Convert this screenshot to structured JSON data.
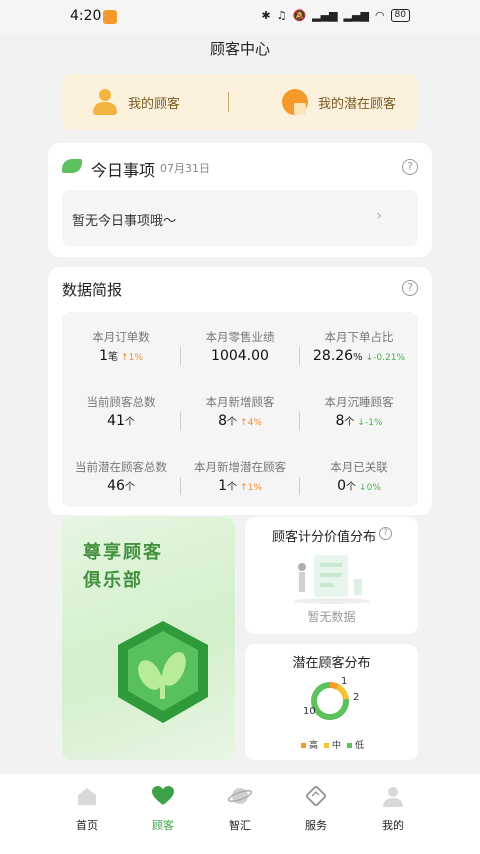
{
  "status_bar": {
    "time": "4:20",
    "battery": "80"
  },
  "header": {
    "title": "顾客中心"
  },
  "quick_links": [
    {
      "label": "我的顾客",
      "icon": "customer-icon"
    },
    {
      "label": "我的潜在顾客",
      "icon": "prospect-icon"
    }
  ],
  "today": {
    "title": "今日事项",
    "date": "07月31日",
    "empty_text": "暂无今日事项哦～",
    "help": "?"
  },
  "data_report": {
    "title": "数据简报",
    "help": "?",
    "stats": [
      {
        "label": "本月订单数",
        "value": "1",
        "unit": "笔",
        "trend": "1%",
        "direction": "up"
      },
      {
        "label": "本月零售业绩",
        "value": "1004.00",
        "unit": "",
        "trend": "",
        "direction": ""
      },
      {
        "label": "本月下单占比",
        "value": "28.26",
        "unit": "%",
        "trend": "-0.21%",
        "direction": "down"
      },
      {
        "label": "当前顾客总数",
        "value": "41",
        "unit": "个",
        "trend": "",
        "direction": ""
      },
      {
        "label": "本月新增顾客",
        "value": "8",
        "unit": "个",
        "trend": "4%",
        "direction": "up"
      },
      {
        "label": "本月沉睡顾客",
        "value": "8",
        "unit": "个",
        "trend": "-1%",
        "direction": "down"
      },
      {
        "label": "当前潜在顾客总数",
        "value": "46",
        "unit": "个",
        "trend": "",
        "direction": ""
      },
      {
        "label": "本月新增潜在顾客",
        "value": "1",
        "unit": "个",
        "trend": "1%",
        "direction": "up"
      },
      {
        "label": "本月已关联",
        "value": "0",
        "unit": "个",
        "trend": "0%",
        "direction": "down"
      }
    ]
  },
  "club": {
    "title_line1": "尊享顾客",
    "title_line2": "俱乐部"
  },
  "score_distribution": {
    "title": "顾客计分价值分布",
    "help": "?",
    "empty_text": "暂无数据"
  },
  "potential_distribution": {
    "title": "潜在顾客分布",
    "labels": {
      "high_count": "1",
      "mid_count": "2",
      "low_count": "10"
    },
    "legend": [
      {
        "label": "高",
        "color": "#f59a2a"
      },
      {
        "label": "中",
        "color": "#f2c530"
      },
      {
        "label": "低",
        "color": "#5cc15f"
      }
    ]
  },
  "chart_data": {
    "type": "pie",
    "title": "潜在顾客分布",
    "categories": [
      "高",
      "中",
      "低"
    ],
    "values": [
      1,
      2,
      10
    ]
  },
  "tabbar": {
    "active": "顾客",
    "tabs": [
      {
        "label": "首页",
        "icon": "home-icon"
      },
      {
        "label": "顾客",
        "icon": "heart-icon"
      },
      {
        "label": "智汇",
        "icon": "planet-icon"
      },
      {
        "label": "服务",
        "icon": "service-icon"
      },
      {
        "label": "我的",
        "icon": "profile-icon"
      }
    ]
  }
}
